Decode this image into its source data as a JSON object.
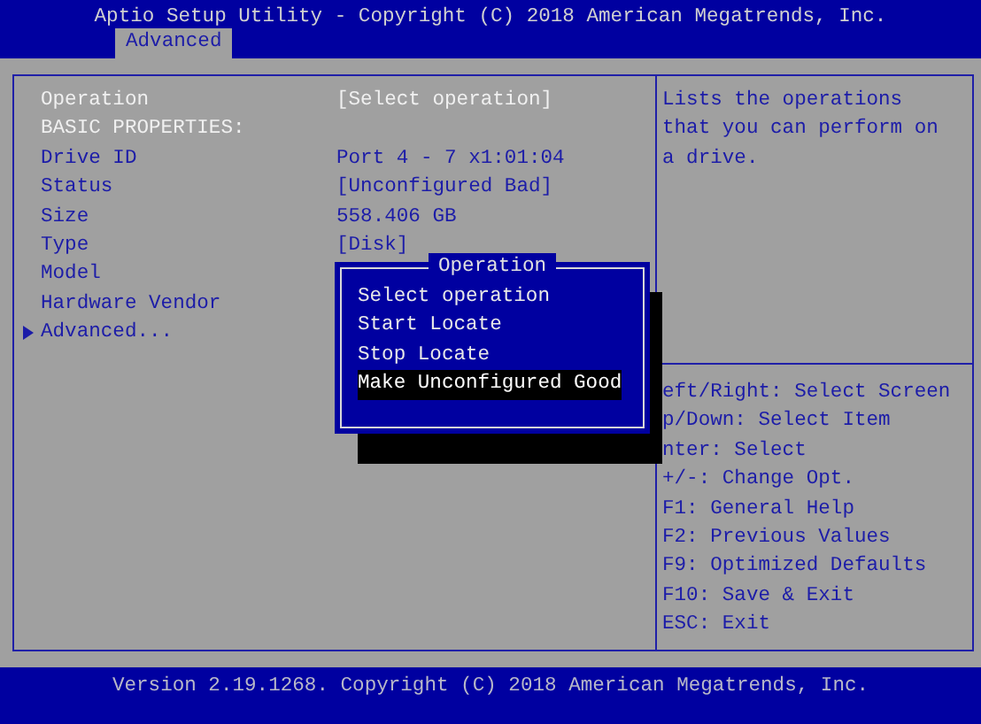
{
  "title": "Aptio Setup Utility - Copyright (C) 2018 American Megatrends, Inc.",
  "tabs": [
    {
      "label": "Advanced",
      "selected": true
    }
  ],
  "items": [
    {
      "kind": "setting",
      "label": "Operation",
      "value": "[Select operation]",
      "selected": true
    },
    {
      "kind": "header",
      "label": "BASIC PROPERTIES:"
    },
    {
      "kind": "setting",
      "label": "Drive ID",
      "value": "Port 4 - 7 x1:01:04",
      "selected": false
    },
    {
      "kind": "setting",
      "label": "Status",
      "value": "[Unconfigured Bad]",
      "selected": false
    },
    {
      "kind": "setting",
      "label": "Size",
      "value": "558.406 GB",
      "selected": false
    },
    {
      "kind": "setting",
      "label": "Type",
      "value": "[Disk]",
      "selected": false
    },
    {
      "kind": "setting",
      "label": "Model",
      "selected": false
    },
    {
      "kind": "setting",
      "label": "Hardware Vendor",
      "selected": false
    },
    {
      "kind": "submenu",
      "label": "Advanced...",
      "selected": false
    }
  ],
  "help_text": "Lists the operations that you can perform on a drive.",
  "keys": [
    "eft/Right: Select Screen",
    "p/Down: Select Item",
    "nter: Select",
    "+/-: Change Opt.",
    "F1: General Help",
    "F2: Previous Values",
    "F9: Optimized Defaults",
    "F10: Save & Exit",
    "ESC: Exit"
  ],
  "popup": {
    "title": "Operation",
    "options": [
      {
        "label": "Select operation",
        "selected": false
      },
      {
        "label": "Start Locate",
        "selected": false
      },
      {
        "label": "Stop Locate",
        "selected": false
      },
      {
        "label": "Make Unconfigured Good",
        "selected": true
      }
    ]
  },
  "footer": "Version 2.19.1268. Copyright (C) 2018 American Megatrends, Inc."
}
